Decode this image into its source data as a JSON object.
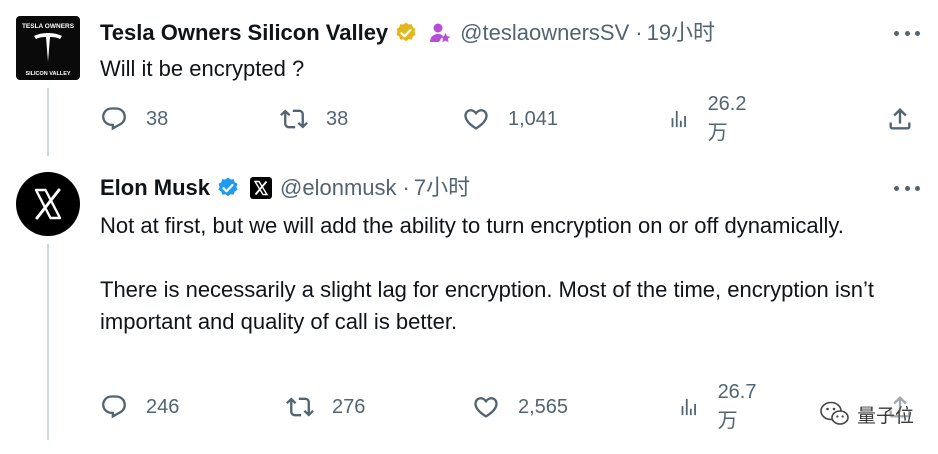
{
  "tweets": [
    {
      "author_name": "Tesla Owners Silicon Valley",
      "avatar_text_top": "TESLA OWNERS",
      "avatar_text_bottom": "SILICON VALLEY",
      "handle": "@teslaownersSV",
      "separator": "·",
      "time": "19小时",
      "paragraphs": [
        "Will it be encrypted ?"
      ],
      "stats": {
        "replies": "38",
        "retweets": "38",
        "likes": "1,041",
        "views": "26.2万"
      }
    },
    {
      "author_name": "Elon Musk",
      "handle": "@elonmusk",
      "separator": "·",
      "time": "7小时",
      "paragraphs": [
        "Not at first, but we will add the ability to turn encryption on or off dynamically.",
        "There is necessarily a slight lag for encryption. Most of the time, encryption isn’t important and quality of call is better."
      ],
      "stats": {
        "replies": "246",
        "retweets": "276",
        "likes": "2,565",
        "views": "26.7万"
      }
    }
  ],
  "watermark": "量子位",
  "colors": {
    "gold_badge": "#e2b719",
    "blue_badge": "#1d9bf0",
    "affiliate_purple": "#b84ed6",
    "meta_gray": "#536471",
    "thread_line": "#cfd9de"
  },
  "icons": [
    "reply-icon",
    "retweet-icon",
    "like-icon",
    "views-icon",
    "share-icon",
    "more-icon",
    "verified-gold-icon",
    "verified-blue-icon",
    "affiliate-icon",
    "x-logo-icon",
    "wechat-icon"
  ]
}
